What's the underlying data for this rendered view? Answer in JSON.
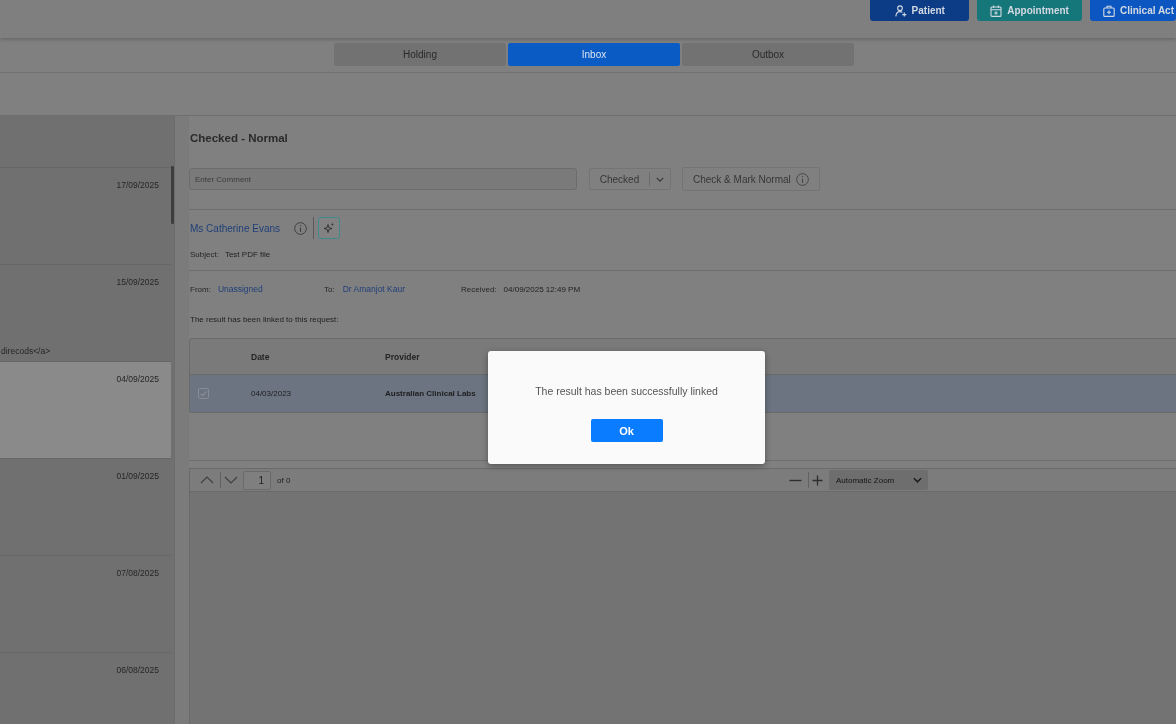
{
  "header_actions": [
    {
      "label": "Patient",
      "kind": "patient",
      "color": "#0c3c86"
    },
    {
      "label": "Appointment",
      "kind": "appointment",
      "color": "#16777a"
    },
    {
      "label": "Clinical Act",
      "kind": "clinical",
      "color": "#0b56c0"
    }
  ],
  "tabs": [
    {
      "label": "Holding",
      "selected": false
    },
    {
      "label": "Inbox",
      "selected": true
    },
    {
      "label": "Outbox",
      "selected": false
    }
  ],
  "message_list": {
    "items": [
      {
        "date": "17/09/2025",
        "selected": false
      },
      {
        "date": "15/09/2025",
        "preview": "direcods</a>",
        "selected": false
      },
      {
        "date": "04/09/2025",
        "selected": true
      },
      {
        "date": "01/09/2025",
        "selected": false
      },
      {
        "date": "07/08/2025",
        "selected": false
      },
      {
        "date": "06/08/2025",
        "selected": false
      }
    ]
  },
  "detail": {
    "status_title": "Checked - Normal",
    "comment": {
      "placeholder": "Enter Comment"
    },
    "status_select": {
      "value": "Checked"
    },
    "mark_button": {
      "label": "Check & Mark Normal"
    },
    "patient_name": "Ms Catherine Evans",
    "subject_label": "Subject:",
    "subject": "Test PDF file",
    "from_label": "From:",
    "from": "Unassigned",
    "to_label": "To:",
    "to": "Dr Amanjot Kaur",
    "received_label": "Received:",
    "received": "04/09/2025 12:49 PM",
    "linked_note": "The result has been linked to this request:",
    "table": {
      "columns": [
        "Date",
        "Provider"
      ],
      "rows": [
        {
          "checked": true,
          "selected": true,
          "cells": [
            "04/03/2023",
            "Australian Clinical Labs"
          ]
        }
      ]
    }
  },
  "pdf_viewer": {
    "page": "1",
    "page_count": "of 0",
    "zoom": "Automatic Zoom"
  },
  "dialog": {
    "message": "The result has been successfully linked",
    "button": "Ok"
  }
}
